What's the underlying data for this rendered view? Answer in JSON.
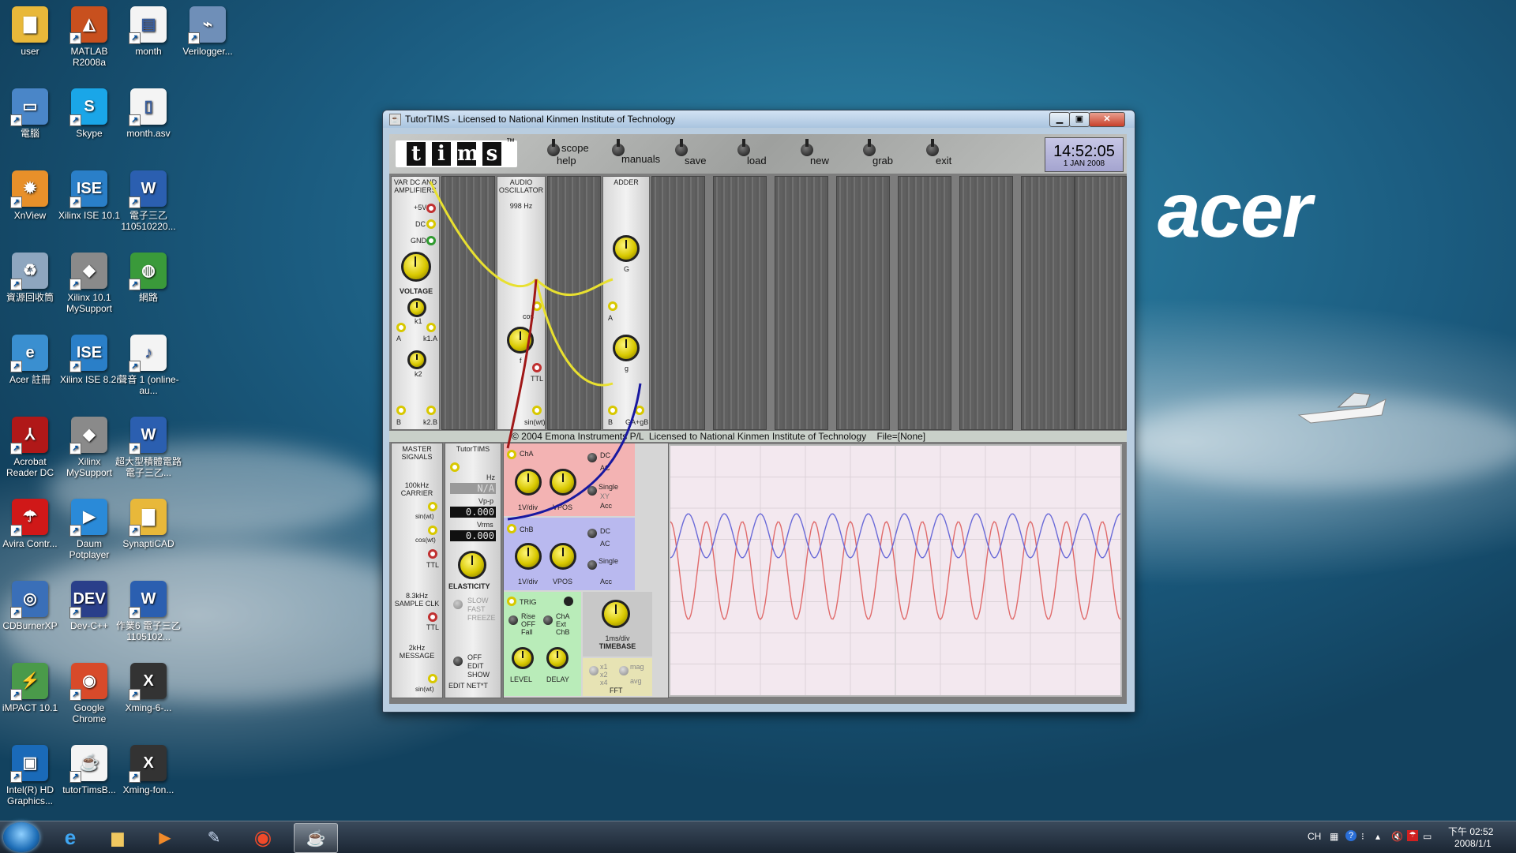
{
  "desktop": {
    "icons": [
      {
        "label": "user",
        "icon": "folder-icon",
        "color": "#e8b83a",
        "glyph": "▇"
      },
      {
        "label": "MATLAB R2008a",
        "icon": "matlab-icon",
        "color": "#c8501e",
        "glyph": "◭"
      },
      {
        "label": "month",
        "icon": "document-icon",
        "color": "#f4f4f4",
        "glyph": "▤"
      },
      {
        "label": "Verilogger...",
        "icon": "verilogger-icon",
        "color": "#6f8fb8",
        "glyph": "⌁"
      },
      {
        "label": "電腦",
        "icon": "computer-icon",
        "color": "#4a86c8",
        "glyph": "▭"
      },
      {
        "label": "Skype",
        "icon": "skype-icon",
        "color": "#1aa6e8",
        "glyph": "S"
      },
      {
        "label": "month.asv",
        "icon": "file-icon",
        "color": "#f4f4f4",
        "glyph": "▯"
      },
      {
        "label": "XnView",
        "icon": "xnview-icon",
        "color": "#e8902a",
        "glyph": "✹"
      },
      {
        "label": "Xilinx ISE 10.1",
        "icon": "xilinx-ise-icon",
        "color": "#2a7fc8",
        "glyph": "ISE"
      },
      {
        "label": "電子三乙 110510220...",
        "icon": "word-doc-icon",
        "color": "#2b5fb0",
        "glyph": "W"
      },
      {
        "label": "資源回收筒",
        "icon": "recycle-bin-icon",
        "color": "#8ea6bf",
        "glyph": "♻"
      },
      {
        "label": "Xilinx 10.1 MySupport",
        "icon": "xilinx-support-icon",
        "color": "#8a8a8a",
        "glyph": "◆"
      },
      {
        "label": "網路",
        "icon": "network-icon",
        "color": "#3a9a3a",
        "glyph": "◍"
      },
      {
        "label": "Acer 註冊",
        "icon": "acer-register-icon",
        "color": "#3a8fd0",
        "glyph": "e"
      },
      {
        "label": "Xilinx ISE 8.2i",
        "icon": "xilinx-ise-old-icon",
        "color": "#2a7fc8",
        "glyph": "ISE"
      },
      {
        "label": "聲音 1 (online-au...",
        "icon": "mp3-icon",
        "color": "#f4f4f4",
        "glyph": "♪"
      },
      {
        "label": "Acrobat Reader DC",
        "icon": "acrobat-icon",
        "color": "#b01818",
        "glyph": "⅄"
      },
      {
        "label": "Xilinx MySupport",
        "icon": "xilinx-mysupport-icon",
        "color": "#8a8a8a",
        "glyph": "◆"
      },
      {
        "label": "超大型積體電路電子三乙...",
        "icon": "word-doc-icon-2",
        "color": "#2b5fb0",
        "glyph": "W"
      },
      {
        "label": "Avira Contr...",
        "icon": "avira-icon",
        "color": "#d01818",
        "glyph": "☂"
      },
      {
        "label": "Daum Potplayer",
        "icon": "potplayer-icon",
        "color": "#2a8ad8",
        "glyph": "▶"
      },
      {
        "label": "SynaptiCAD",
        "icon": "folder-synapticad-icon",
        "color": "#e8b83a",
        "glyph": "▇"
      },
      {
        "label": "CDBurnerXP",
        "icon": "cdburner-icon",
        "color": "#3a6fb8",
        "glyph": "◎"
      },
      {
        "label": "Dev-C++",
        "icon": "devcpp-icon",
        "color": "#2a3f8a",
        "glyph": "DEV"
      },
      {
        "label": "作業6 電子三乙1105102...",
        "icon": "word-doc-icon-3",
        "color": "#2b5fb0",
        "glyph": "W"
      },
      {
        "label": "iMPACT 10.1",
        "icon": "impact-icon",
        "color": "#4a9a4a",
        "glyph": "⚡"
      },
      {
        "label": "Google Chrome",
        "icon": "chrome-icon",
        "color": "#d84a2a",
        "glyph": "◉"
      },
      {
        "label": "Xming-6-...",
        "icon": "xming-icon",
        "color": "#333333",
        "glyph": "X"
      },
      {
        "label": "Intel(R) HD Graphics...",
        "icon": "intel-graphics-icon",
        "color": "#1a6ab8",
        "glyph": "▣"
      },
      {
        "label": "tutorTimsB...",
        "icon": "tutortims-file-icon",
        "color": "#f4f4f4",
        "glyph": "☕"
      },
      {
        "label": "Xming-fon...",
        "icon": "xming-fonts-icon",
        "color": "#333333",
        "glyph": "X"
      }
    ],
    "wallpaper_logo": "acer"
  },
  "taskbar": {
    "apps": [
      {
        "name": "internet-explorer",
        "glyph": "e"
      },
      {
        "name": "file-explorer",
        "glyph": "▆"
      },
      {
        "name": "media-player",
        "glyph": "▶"
      },
      {
        "name": "paint-tool",
        "glyph": "✎"
      },
      {
        "name": "chrome",
        "glyph": "◉"
      },
      {
        "name": "java-tutortims",
        "glyph": "☕"
      }
    ],
    "lang": "CH",
    "time": "下午 02:52",
    "date": "2008/1/1"
  },
  "window": {
    "title": "TutorTIMS - Licensed to National Kinmen Institute of Technology",
    "logo_letters": [
      "t",
      "i",
      "m",
      "s"
    ],
    "tm": "™",
    "toolbar": [
      {
        "label": "scope",
        "label2": "help"
      },
      {
        "label": "manuals"
      },
      {
        "label": "save"
      },
      {
        "label": "load"
      },
      {
        "label": "new"
      },
      {
        "label": "grab"
      },
      {
        "label": "exit"
      }
    ],
    "clock_time": "14:52:05",
    "clock_date": "1 JAN 2008",
    "copyright": "© 2004 Emona Instruments P/L  Licensed to National Kinmen Institute of Technology    File=[None]",
    "modules": {
      "vardc": {
        "title": "VAR DC AND AMPLIFIERS",
        "plus5": "+5V",
        "dc": "DC",
        "gnd": "GND",
        "voltage": "VOLTAGE",
        "k1": "k1",
        "k2": "k2",
        "a": "A",
        "k1a": "k1.A",
        "b": "B",
        "k2b": "k2.B"
      },
      "audio": {
        "title": "AUDIO OSCILLATOR",
        "freq": "998 Hz",
        "cos": "cos",
        "f": "f",
        "ttl": "TTL",
        "sin": "sin(wt)"
      },
      "adder": {
        "title": "ADDER",
        "G": "G",
        "A": "A",
        "g": "g",
        "B": "B",
        "out": "GA+gB"
      },
      "master": {
        "title": "MASTER SIGNALS",
        "carrier": "100kHz CARRIER",
        "sin": "sin(wt)",
        "cos": "cos(wt)",
        "ttl": "TTL",
        "sample": "8.3kHz SAMPLE CLK",
        "ttl2": "TTL",
        "msg": "2kHz MESSAGE",
        "sin2": "sin(wt)"
      },
      "tutortims": {
        "title": "TutorTIMS",
        "hz": "Hz",
        "freq_val": "N/A",
        "vpp": "Vp-p",
        "vpp_val": "0.000",
        "vrms": "Vrms",
        "vrms_val": "0.000",
        "elasticity": "ELASTICITY",
        "slow": "SLOW",
        "fast": "FAST",
        "freeze": "FREEZE",
        "off": "OFF",
        "edit": "EDIT",
        "show": "SHOW",
        "editnet": "EDIT NET*T"
      },
      "scope_ctrl": {
        "cha": "ChA",
        "chb": "ChB",
        "vdiv": "1V/div",
        "vpos": "VPOS",
        "dc": "DC",
        "ac": "AC",
        "single": "Single",
        "xy": "XY",
        "acc": "Acc",
        "trig": "TRIG",
        "rise": "Rise",
        "off": "OFF",
        "fall": "Fall",
        "cha2": "ChA",
        "ext": "Ext",
        "chb2": "ChB",
        "level": "LEVEL",
        "delay": "DELAY",
        "timebase_val": "1ms/div",
        "timebase": "TIMEBASE",
        "fft": "FFT",
        "x1": "x1",
        "x2": "x2",
        "x4": "x4",
        "mag": "mag",
        "avg": "avg"
      }
    }
  },
  "scope_display": {
    "channel_a_color": "#e06a6a",
    "channel_b_color": "#6a6ad8",
    "cycles": 12.5
  }
}
